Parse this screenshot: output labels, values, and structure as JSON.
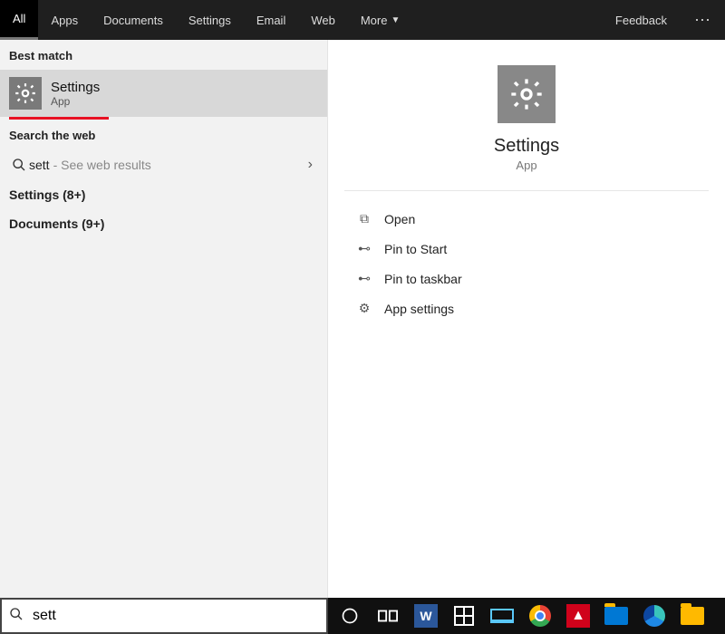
{
  "tabs": {
    "all": "All",
    "apps": "Apps",
    "documents": "Documents",
    "settings": "Settings",
    "email": "Email",
    "web": "Web",
    "more": "More",
    "feedback": "Feedback"
  },
  "left": {
    "best_match_label": "Best match",
    "best_title": "Settings",
    "best_sub": "App",
    "search_web_label": "Search the web",
    "web_query": "sett",
    "web_hint": "- See web results",
    "cat_settings": "Settings (8+)",
    "cat_documents": "Documents (9+)"
  },
  "preview": {
    "title": "Settings",
    "sub": "App",
    "open": "Open",
    "pin_start": "Pin to Start",
    "pin_taskbar": "Pin to taskbar",
    "app_settings": "App settings"
  },
  "search": {
    "value": "sett"
  }
}
